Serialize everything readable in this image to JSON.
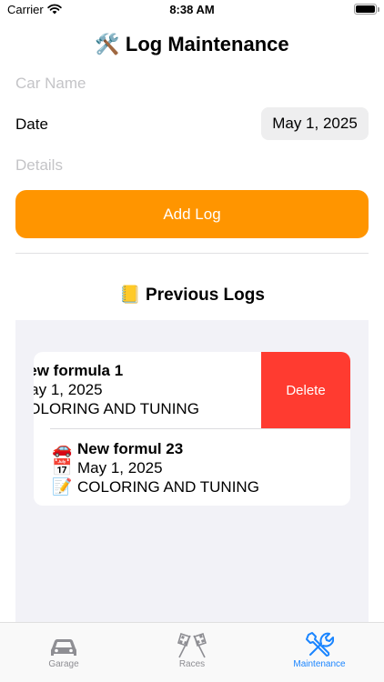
{
  "status_bar": {
    "carrier": "Carrier",
    "time": "8:38 AM"
  },
  "title": {
    "emoji": "🛠️",
    "text": "Log Maintenance"
  },
  "form": {
    "car_name_placeholder": "Car Name",
    "date_label": "Date",
    "date_value": "May 1, 2025",
    "details_placeholder": "Details",
    "add_button": "Add Log"
  },
  "section": {
    "emoji": "📒",
    "text": "Previous Logs"
  },
  "logs": [
    {
      "car_emoji": "🚗",
      "name": "New formula 1",
      "date_emoji": "📅",
      "date": "May 1, 2025",
      "details_emoji": "📝",
      "details": "COLORING AND TUNING",
      "delete_label": "Delete"
    },
    {
      "car_emoji": "🚗",
      "name": "New formul 23",
      "date_emoji": "📅",
      "date": "May 1, 2025",
      "details_emoji": "📝",
      "details": "COLORING AND TUNING"
    }
  ],
  "tabs": [
    {
      "label": "Garage",
      "icon": "car-icon"
    },
    {
      "label": "Races",
      "icon": "checkered-flags-icon"
    },
    {
      "label": "Maintenance",
      "icon": "wrench-screwdriver-icon",
      "active": true
    }
  ],
  "colors": {
    "accent": "#ff9500",
    "delete": "#ff3b30",
    "tab_active": "#1a85ff",
    "tab_inactive": "#8e8e93"
  }
}
